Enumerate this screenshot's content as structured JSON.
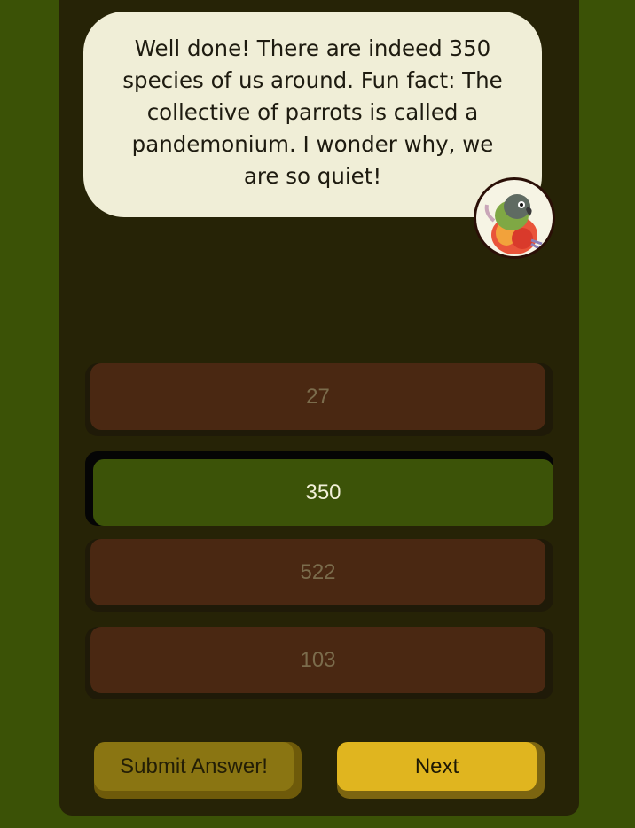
{
  "speech_bubble": {
    "text": "Well done! There are indeed 350 species of us around. Fun fact: The collective of parrots is called a pandemonium. I wonder why, we are so quiet!"
  },
  "avatar": {
    "icon": "parrot-icon"
  },
  "options": [
    {
      "label": "27",
      "selected": false
    },
    {
      "label": "350",
      "selected": true
    },
    {
      "label": "522",
      "selected": false
    },
    {
      "label": "103",
      "selected": false
    }
  ],
  "buttons": {
    "submit_label": "Submit Answer!",
    "next_label": "Next"
  },
  "colors": {
    "background": "#3b5206",
    "panel": "#262306",
    "bubble": "#f0eed7",
    "option": "#4a2812",
    "option_selected": "#3c5308",
    "next_button": "#e0b51f",
    "submit_button": "#8a7512"
  }
}
